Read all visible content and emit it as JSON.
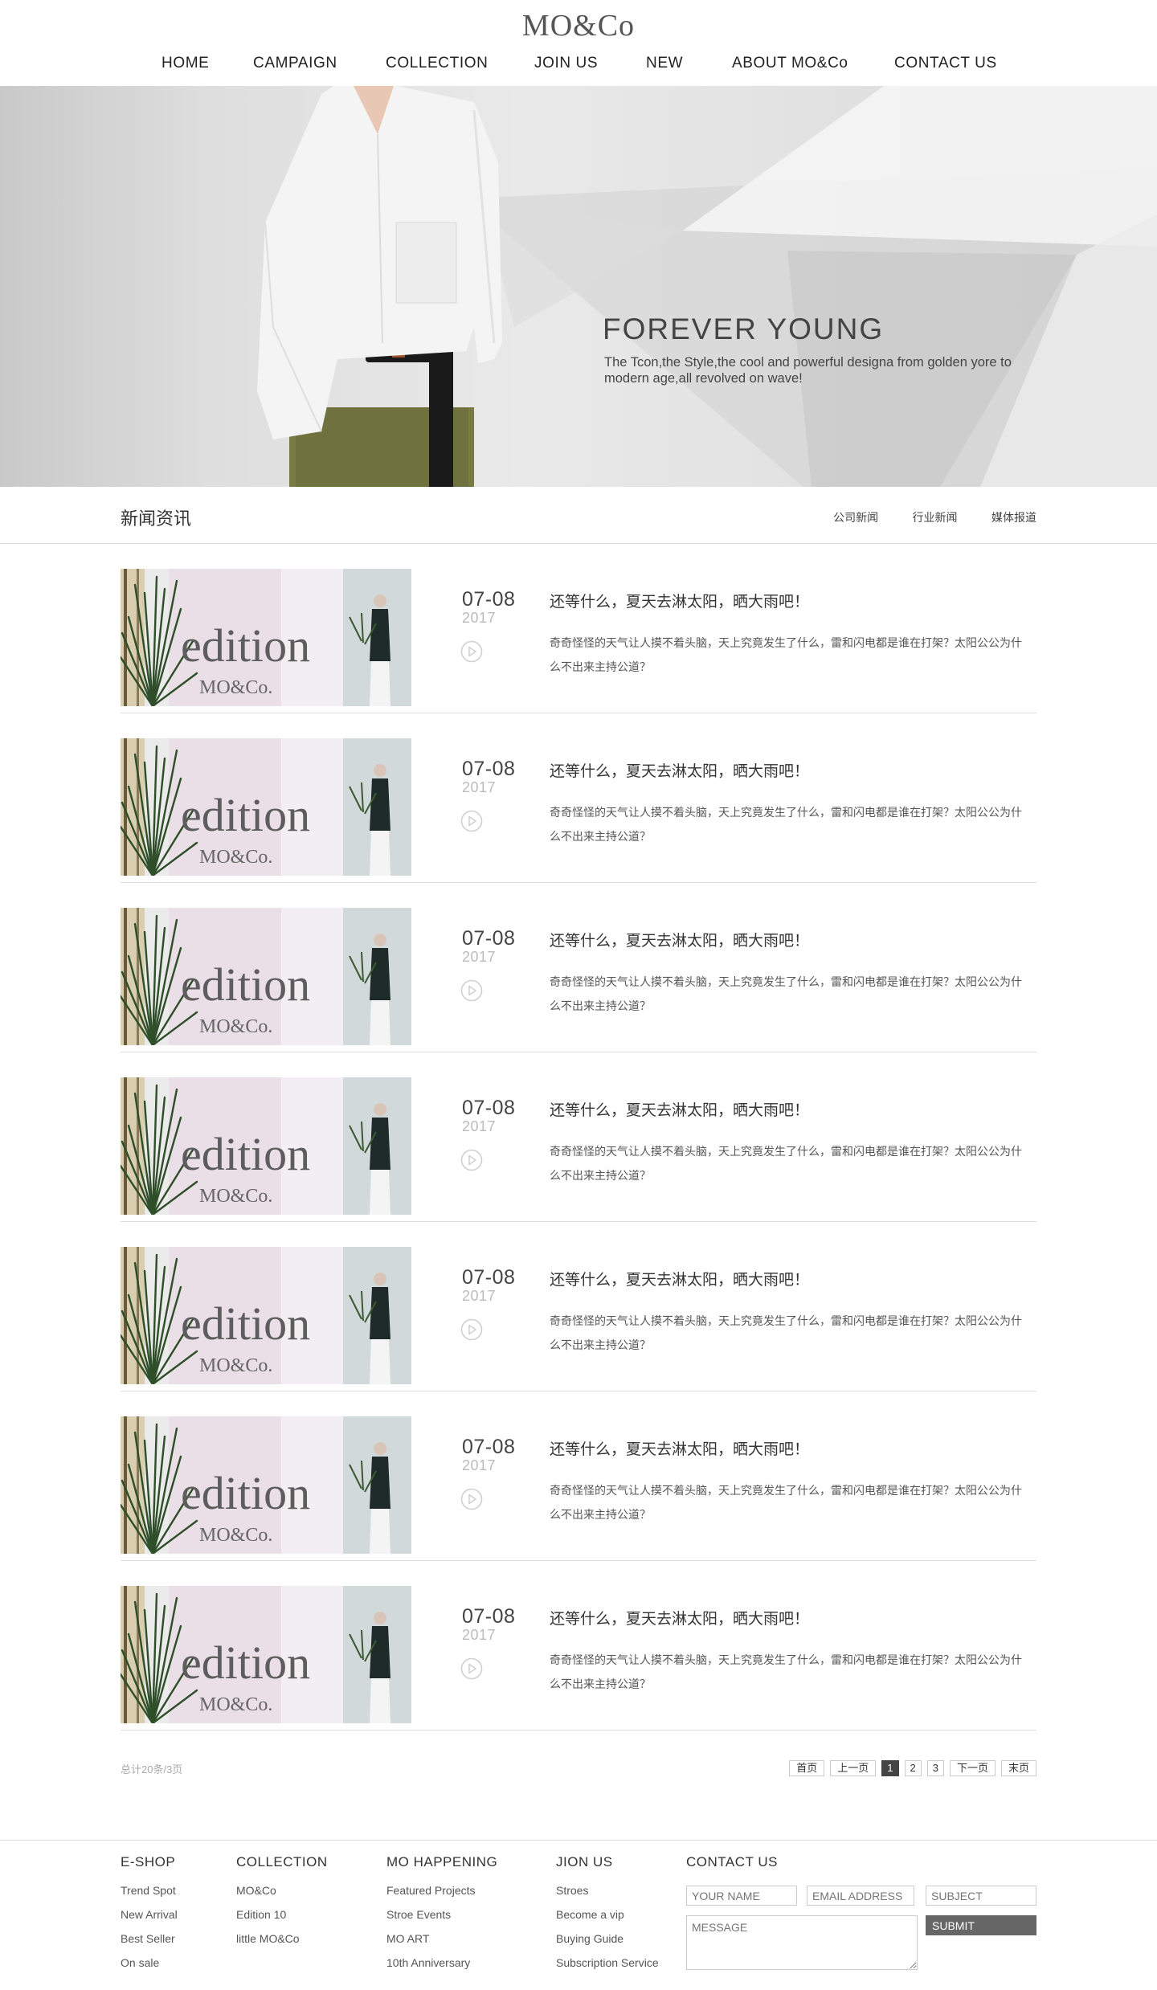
{
  "brand": {
    "logo": "MO&Co"
  },
  "nav": [
    "HOME",
    "CAMPAIGN",
    "COLLECTION",
    "JOIN US",
    "NEW",
    "ABOUT MO&Co",
    "CONTACT US"
  ],
  "banner": {
    "title": "FOREVER YOUNG",
    "subtitle": "The Tcon,the Style,the cool and powerful designa from golden yore to modern age,all revolved on wave!"
  },
  "news_section": {
    "title": "新闻资讯",
    "tabs": [
      "公司新闻",
      "行业新闻",
      "媒体报道"
    ]
  },
  "news": [
    {
      "date": "07-08",
      "year": "2017",
      "title": "还等什么，夏天去淋太阳，晒大雨吧！",
      "desc": "奇奇怪怪的天气让人摸不着头脑，天上究竟发生了什么，雷和闪电都是谁在打架？太阳公公为什么不出来主持公道？",
      "thumb_word": "edition",
      "thumb_brand": "MO&Co."
    },
    {
      "date": "07-08",
      "year": "2017",
      "title": "还等什么，夏天去淋太阳，晒大雨吧！",
      "desc": "奇奇怪怪的天气让人摸不着头脑，天上究竟发生了什么，雷和闪电都是谁在打架？太阳公公为什么不出来主持公道？",
      "thumb_word": "edition",
      "thumb_brand": "MO&Co."
    },
    {
      "date": "07-08",
      "year": "2017",
      "title": "还等什么，夏天去淋太阳，晒大雨吧！",
      "desc": "奇奇怪怪的天气让人摸不着头脑，天上究竟发生了什么，雷和闪电都是谁在打架？太阳公公为什么不出来主持公道？",
      "thumb_word": "edition",
      "thumb_brand": "MO&Co."
    },
    {
      "date": "07-08",
      "year": "2017",
      "title": "还等什么，夏天去淋太阳，晒大雨吧！",
      "desc": "奇奇怪怪的天气让人摸不着头脑，天上究竟发生了什么，雷和闪电都是谁在打架？太阳公公为什么不出来主持公道？",
      "thumb_word": "edition",
      "thumb_brand": "MO&Co."
    },
    {
      "date": "07-08",
      "year": "2017",
      "title": "还等什么，夏天去淋太阳，晒大雨吧！",
      "desc": "奇奇怪怪的天气让人摸不着头脑，天上究竟发生了什么，雷和闪电都是谁在打架？太阳公公为什么不出来主持公道？",
      "thumb_word": "edition",
      "thumb_brand": "MO&Co."
    },
    {
      "date": "07-08",
      "year": "2017",
      "title": "还等什么，夏天去淋太阳，晒大雨吧！",
      "desc": "奇奇怪怪的天气让人摸不着头脑，天上究竟发生了什么，雷和闪电都是谁在打架？太阳公公为什么不出来主持公道？",
      "thumb_word": "edition",
      "thumb_brand": "MO&Co."
    },
    {
      "date": "07-08",
      "year": "2017",
      "title": "还等什么，夏天去淋太阳，晒大雨吧！",
      "desc": "奇奇怪怪的天气让人摸不着头脑，天上究竟发生了什么，雷和闪电都是谁在打架？太阳公公为什么不出来主持公道？",
      "thumb_word": "edition",
      "thumb_brand": "MO&Co."
    }
  ],
  "pagination": {
    "total": "总计20条/3页",
    "first": "首页",
    "prev": "上一页",
    "pages": [
      "1",
      "2",
      "3"
    ],
    "current": "1",
    "next": "下一页",
    "last": "末页"
  },
  "footer": {
    "eshop": {
      "title": "E-SHOP",
      "links": [
        "Trend Spot",
        "New Arrival",
        "Best Seller",
        "On sale"
      ]
    },
    "collection": {
      "title": "COLLECTION",
      "links": [
        "MO&Co",
        "Edition 10",
        "little MO&Co"
      ]
    },
    "happening": {
      "title": "MO HAPPENING",
      "links": [
        "Featured Projects",
        "Stroe Events",
        "MO ART",
        "10th Anniversary"
      ]
    },
    "join": {
      "title": "JION US",
      "links": [
        "Stroes",
        "Become a vip",
        "Buying Guide",
        "Subscription Service"
      ]
    },
    "contact": {
      "title": "CONTACT US",
      "name_placeholder": "YOUR NAME",
      "email_placeholder": "EMAIL ADDRESS",
      "subject_placeholder": "SUBJECT",
      "message_placeholder": "MESSAGE",
      "submit": "SUBMIT"
    }
  },
  "icons": {
    "play": "play-circle-icon"
  },
  "colors": {
    "text": "#333333",
    "muted": "#bbbbbb",
    "active_page": "#444444",
    "submit_bg": "#666666"
  }
}
